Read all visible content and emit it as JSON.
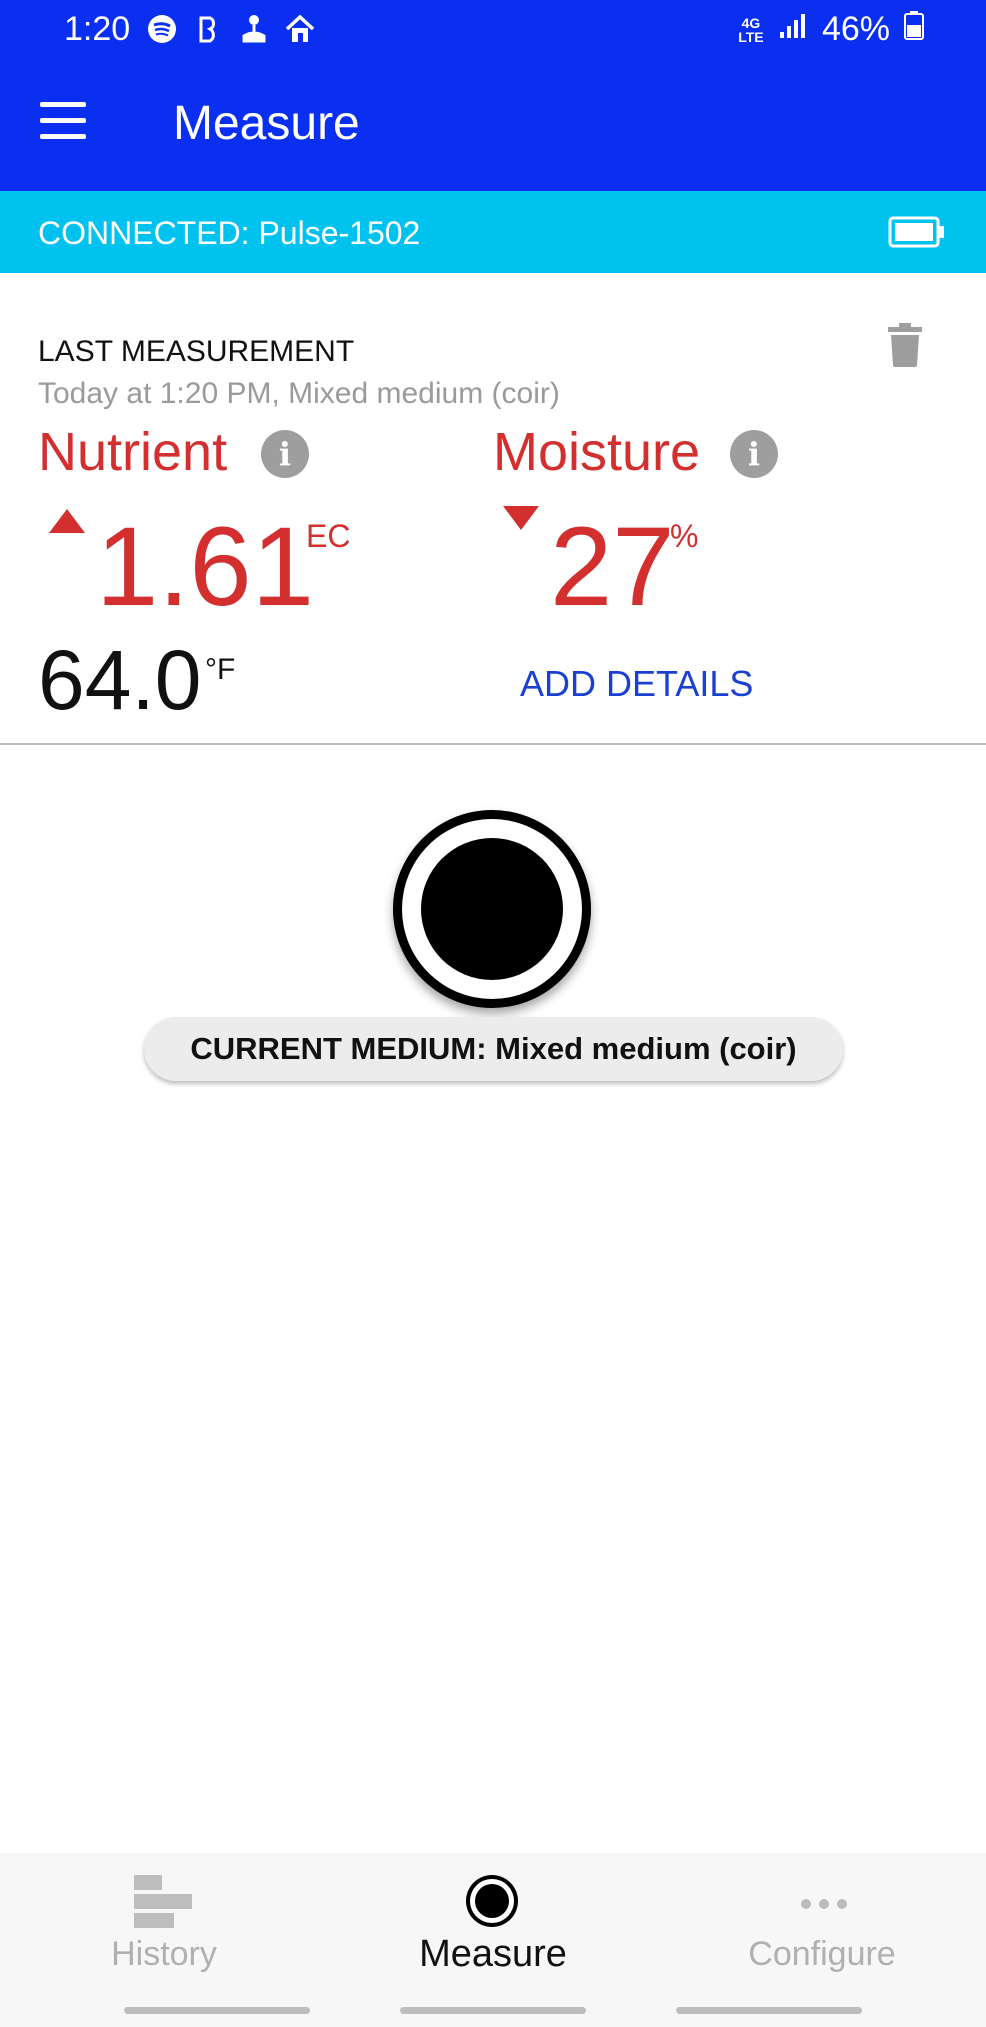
{
  "status_bar": {
    "time": "1:20",
    "battery_text": "46%",
    "network": "4G LTE",
    "icons": [
      "spotify-icon",
      "bitmoji-icon",
      "pin-icon",
      "home-icon"
    ]
  },
  "toolbar": {
    "title": "Measure",
    "menu_icon": "hamburger-menu-icon"
  },
  "connection": {
    "label": "CONNECTED: Pulse-1502",
    "battery_icon": "battery-icon"
  },
  "last_measurement": {
    "heading": "LAST MEASUREMENT",
    "subtitle": "Today at 1:20 PM, Mixed medium (coir)",
    "nutrient": {
      "label": "Nutrient",
      "value": "1.61",
      "unit": "EC",
      "trend": "up"
    },
    "moisture": {
      "label": "Moisture",
      "value": "27",
      "unit": "%",
      "trend": "down"
    },
    "temperature": {
      "value": "64.0",
      "unit": "°F"
    },
    "add_details": "ADD DETAILS",
    "info_glyph": "i"
  },
  "current_medium": "CURRENT MEDIUM: Mixed medium (coir)",
  "bottom_nav": {
    "items": [
      {
        "label": "History",
        "icon": "history-icon",
        "active": false
      },
      {
        "label": "Measure",
        "icon": "measure-icon",
        "active": true
      },
      {
        "label": "Configure",
        "icon": "more-dots-icon",
        "active": false
      }
    ]
  },
  "colors": {
    "toolbar": "#0a2ff0",
    "connection_bar": "#00c2ee",
    "value_red": "#d32f2f",
    "link_blue": "#1a3fd3"
  }
}
